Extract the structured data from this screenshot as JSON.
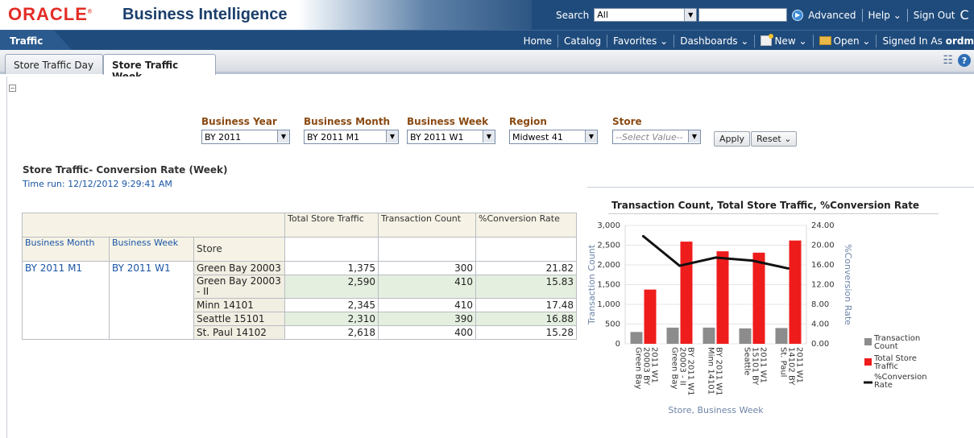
{
  "header": {
    "logo": "ORACLE",
    "app_title": "Business Intelligence",
    "search_label": "Search",
    "search_scope": "All",
    "search_value": "",
    "advanced": "Advanced",
    "help": "Help",
    "signout": "Sign Out"
  },
  "navbar": {
    "dashboard_tab": "Traffic",
    "home": "Home",
    "catalog": "Catalog",
    "favorites": "Favorites",
    "dashboards": "Dashboards",
    "new": "New",
    "open": "Open",
    "signed_in_label": "Signed In As",
    "user": "ordm"
  },
  "page_tabs": [
    {
      "label": "Store Traffic Day",
      "active": false
    },
    {
      "label": "Store Traffic Week",
      "active": true
    }
  ],
  "prompts": {
    "year": {
      "label": "Business Year",
      "value": "BY 2011"
    },
    "month": {
      "label": "Business Month",
      "value": "BY 2011 M1"
    },
    "week": {
      "label": "Business Week",
      "value": "BY 2011 W1"
    },
    "region": {
      "label": "Region",
      "value": "Midwest 41"
    },
    "store": {
      "label": "Store",
      "placeholder": "--Select Value--"
    },
    "apply": "Apply",
    "reset": "Reset"
  },
  "report": {
    "title": "Store Traffic- Conversion Rate (Week)",
    "time_run": "Time run: 12/12/2012 9:29:41 AM"
  },
  "table": {
    "measure_headers": [
      "Total Store Traffic",
      "Transaction Count",
      "%Conversion Rate"
    ],
    "dim_headers": [
      "Business Month",
      "Business Week",
      "Store"
    ],
    "month": "BY 2011 M1",
    "week": "BY 2011 W1",
    "rows": [
      {
        "store": "Green Bay 20003",
        "traffic": "1,375",
        "count": "300",
        "rate": "21.82"
      },
      {
        "store": "Green Bay 20003 - II",
        "traffic": "2,590",
        "count": "410",
        "rate": "15.83"
      },
      {
        "store": "Minn 14101",
        "traffic": "2,345",
        "count": "410",
        "rate": "17.48"
      },
      {
        "store": "Seattle 15101",
        "traffic": "2,310",
        "count": "390",
        "rate": "16.88"
      },
      {
        "store": "St. Paul 14102",
        "traffic": "2,618",
        "count": "400",
        "rate": "15.28"
      }
    ]
  },
  "colors": {
    "transaction": "#8c8c8c",
    "traffic": "#ef1c1c",
    "rate": "#111111"
  },
  "chart_data": {
    "type": "bar",
    "title": "Transaction Count, Total Store Traffic, %Conversion Rate",
    "xlabel": "Store, Business Week",
    "ylabel": "Transaction Count",
    "y2label": "%Conversion Rate",
    "categories": [
      [
        "Green Bay",
        "20003 BY",
        "2011 W1"
      ],
      [
        "Green Bay",
        "20003 - II",
        "BY 2011 W1"
      ],
      [
        "Minn 14101",
        "BY 2011 W1"
      ],
      [
        "Seattle",
        "15101 BY",
        "2011 W1"
      ],
      [
        "St. Paul",
        "14102 BY",
        "2011 W1"
      ]
    ],
    "ylim": [
      0,
      3000
    ],
    "yticks": [
      "0",
      "500",
      "1,000",
      "1,500",
      "2,000",
      "2,500",
      "3,000"
    ],
    "y2lim": [
      0,
      24
    ],
    "y2ticks": [
      "0.00",
      "4.00",
      "8.00",
      "12.00",
      "16.00",
      "20.00",
      "24.00"
    ],
    "series": [
      {
        "name": "Transaction Count",
        "type": "bar",
        "values": [
          300,
          410,
          410,
          390,
          400
        ]
      },
      {
        "name": "Total Store Traffic",
        "type": "bar",
        "values": [
          1375,
          2590,
          2345,
          2310,
          2618
        ]
      },
      {
        "name": "%Conversion Rate",
        "type": "line",
        "axis": "right",
        "values": [
          21.82,
          15.83,
          17.48,
          16.88,
          15.28
        ]
      }
    ],
    "legend": [
      "Transaction Count",
      "Total Store Traffic",
      "%Conversion Rate"
    ],
    "legend_position": "right"
  }
}
